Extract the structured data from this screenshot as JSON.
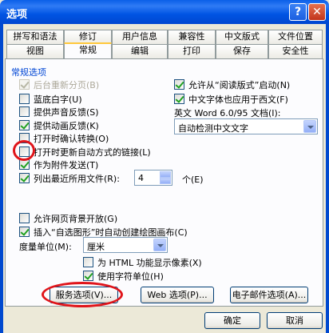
{
  "window": {
    "title": "选项",
    "help_glyph": "?",
    "close_glyph": "✕"
  },
  "tabs_row1": [
    "拼写和语法",
    "修订",
    "用户信息",
    "兼容性",
    "中文版式",
    "文件位置"
  ],
  "tabs_row2": [
    "视图",
    "常规",
    "编辑",
    "打印",
    "保存",
    "安全性"
  ],
  "section_title": "常规选项",
  "left_options": [
    {
      "label": "后台重新分页(B)",
      "checked": true,
      "disabled": true
    },
    {
      "label": "蓝底白字(U)",
      "checked": false,
      "disabled": false
    },
    {
      "label": "提供声音反馈(S)",
      "checked": false,
      "disabled": false
    },
    {
      "label": "提供动画反馈(K)",
      "checked": true,
      "disabled": false
    },
    {
      "label": "打开时确认转换(O)",
      "checked": false,
      "disabled": false
    },
    {
      "label": "打开时更新自动方式的链接(L)",
      "checked": false,
      "disabled": false
    },
    {
      "label": "作为附件发送(T)",
      "checked": true,
      "disabled": false
    },
    {
      "label": "列出最近所用文件(R):",
      "checked": true,
      "disabled": false
    }
  ],
  "recent_files_count": "4",
  "recent_files_unit": "个(E)",
  "right_options": [
    {
      "label": "允许从“阅读版式”启动(N)",
      "checked": true
    },
    {
      "label": "中文字体也应用于西文(F)",
      "checked": true
    }
  ],
  "english_word_label": "英文 Word 6.0/95 文档(I):",
  "english_word_value": "自动检测中文文字",
  "lower_options": [
    {
      "label": "允许网页背景开放(G)",
      "checked": false
    },
    {
      "label": "插入“自选图形”时自动创建绘图画布(C)",
      "checked": true
    }
  ],
  "measure_label": "度量单位(M):",
  "measure_value": "厘米",
  "sub_options": [
    {
      "label": "为 HTML 功能显示像素(X)",
      "checked": false
    },
    {
      "label": "使用字符单位(H)",
      "checked": true
    }
  ],
  "buttons": {
    "service": "服务选项(V)...",
    "web": "Web 选项(P)...",
    "email": "电子邮件选项(A)...",
    "ok": "确定",
    "cancel": "取消"
  }
}
